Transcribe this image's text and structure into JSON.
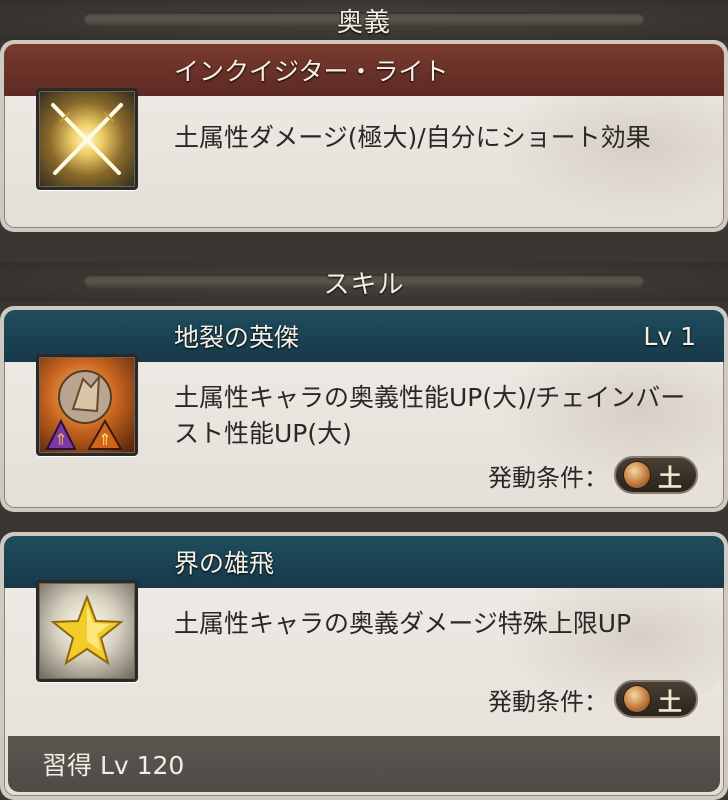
{
  "sections": {
    "ougi_title": "奥義",
    "skill_title": "スキル"
  },
  "ougi": {
    "name": "インクイジター・ライト",
    "description": "土属性ダメージ(極大)/自分にショート効果",
    "icon": "crossed-swords-icon"
  },
  "skills": [
    {
      "name": "地裂の英傑",
      "level": "Lv 1",
      "description": "土属性キャラの奥義性能UP(大)/チェインバースト性能UP(大)",
      "condition_label": "発動条件：",
      "element": "土",
      "icon": "earth-rock-icon"
    },
    {
      "name": "界の雄飛",
      "description": "土属性キャラの奥義ダメージ特殊上限UP",
      "condition_label": "発動条件：",
      "element": "土",
      "icon": "star-icon",
      "learn": "習得 Lv 120"
    }
  ],
  "colors": {
    "ougi_bar": "#6b3328",
    "skill_bar": "#1c4456",
    "element_earth": "#c07a3b"
  }
}
